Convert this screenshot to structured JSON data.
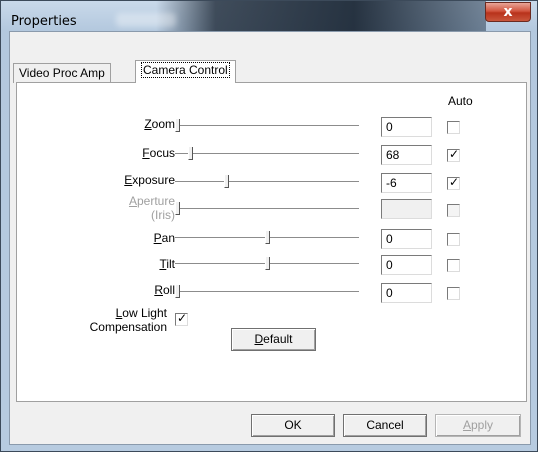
{
  "window": {
    "title": "Properties",
    "close_glyph": "x"
  },
  "tabs": [
    {
      "label": "Video Proc Amp",
      "selected": false
    },
    {
      "label": "Camera Control",
      "selected": true
    }
  ],
  "controls": {
    "auto_header": "Auto",
    "rows": [
      {
        "key": "zoom",
        "label_first": "Z",
        "label_rest": "oom",
        "value": "0",
        "auto": false,
        "enabled": true,
        "position": 0.0
      },
      {
        "key": "focus",
        "label_first": "F",
        "label_rest": "ocus",
        "value": "68",
        "auto": true,
        "enabled": true,
        "position": 0.07
      },
      {
        "key": "exposure",
        "label_first": "E",
        "label_rest": "xposure",
        "value": "-6",
        "auto": true,
        "enabled": true,
        "position": 0.27
      },
      {
        "key": "aperture",
        "label_first": "A",
        "label_rest": "perture",
        "label_line2": "(Iris)",
        "value": "",
        "auto": false,
        "enabled": false,
        "position": 0.0
      },
      {
        "key": "pan",
        "label_first": "P",
        "label_rest": "an",
        "value": "0",
        "auto": false,
        "enabled": true,
        "position": 0.5
      },
      {
        "key": "tilt",
        "label_first": "T",
        "label_rest": "ilt",
        "value": "0",
        "auto": false,
        "enabled": true,
        "position": 0.5
      },
      {
        "key": "roll",
        "label_first": "R",
        "label_rest": "oll",
        "value": "0",
        "auto": false,
        "enabled": true,
        "position": 0.0
      }
    ],
    "low_light": {
      "label_first": "L",
      "label_rest": "ow Light",
      "label_line2": "Compensation",
      "checked": true
    },
    "default_first": "D",
    "default_rest": "efault"
  },
  "footer": {
    "ok": "OK",
    "cancel": "Cancel",
    "apply_first": "A",
    "apply_rest": "pply"
  }
}
